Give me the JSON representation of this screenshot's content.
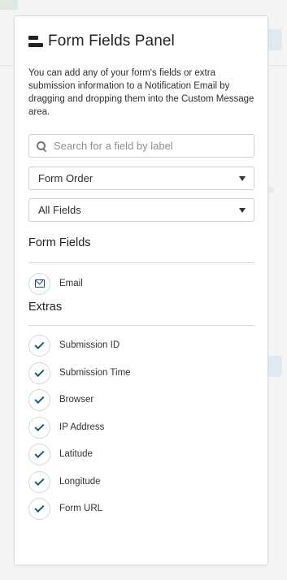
{
  "panel": {
    "title": "Form Fields Panel",
    "title_icon": "fields-panel-icon",
    "description": "You can add any of your form's fields or extra submission information to a Notification Email by dragging and dropping them into the Custom Message area."
  },
  "search": {
    "placeholder": "Search for a field by label",
    "value": ""
  },
  "order_select": {
    "selected": "Form Order"
  },
  "filter_select": {
    "selected": "All Fields"
  },
  "form_fields": {
    "title": "Form Fields",
    "items": [
      {
        "label": "Email",
        "icon": "envelope-icon"
      }
    ]
  },
  "extras": {
    "title": "Extras",
    "items": [
      {
        "label": "Submission ID",
        "icon": "checkmark-icon"
      },
      {
        "label": "Submission Time",
        "icon": "checkmark-icon"
      },
      {
        "label": "Browser",
        "icon": "checkmark-icon"
      },
      {
        "label": "IP Address",
        "icon": "checkmark-icon"
      },
      {
        "label": "Latitude",
        "icon": "checkmark-icon"
      },
      {
        "label": "Longitude",
        "icon": "checkmark-icon"
      },
      {
        "label": "Form URL",
        "icon": "checkmark-icon"
      }
    ]
  },
  "colors": {
    "icon_accent": "#1f5a70",
    "panel_bg": "#ffffff",
    "page_bg": "#f4f4f4"
  }
}
